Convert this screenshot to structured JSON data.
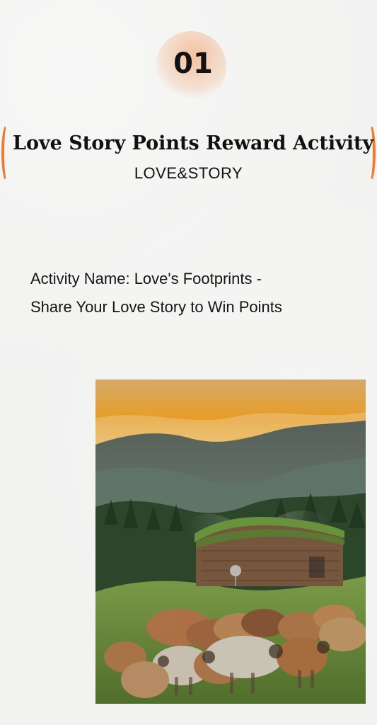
{
  "header": {
    "number": "01",
    "title": "Love Story Points Reward Activity",
    "subtitle": "LOVE&STORY"
  },
  "activity": {
    "description": "Activity Name: Love's Footprints - Share Your Love Story to Win Points"
  },
  "image": {
    "alt": "Sheep grazing in front of a log cabin with grass roof, mountains and sunset sky",
    "colors": {
      "sky_top": "#e3b56d",
      "sky_glow": "#f5a628",
      "mountain": "#6f7f75",
      "forest": "#2f4a2e",
      "grass": "#6e8e3f",
      "cabin_wood": "#8f6a4b",
      "accent": "#ee7b34"
    }
  }
}
